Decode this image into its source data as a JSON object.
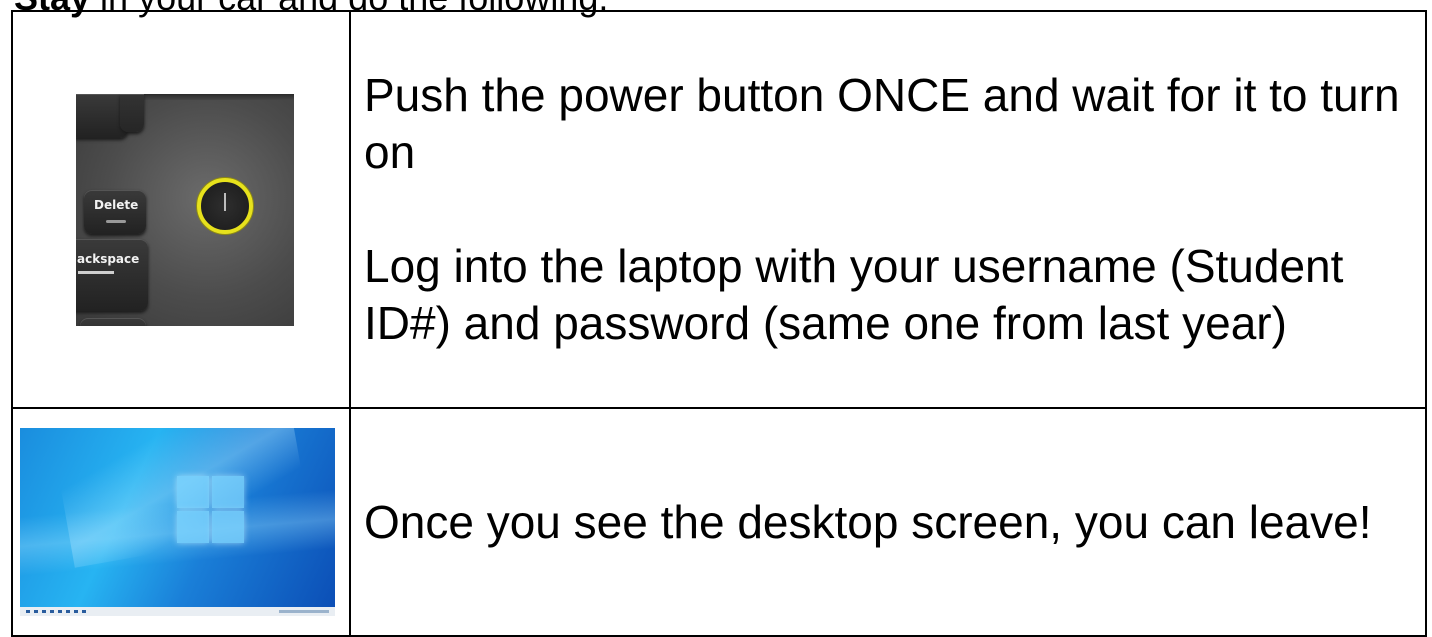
{
  "intro": {
    "bold": "Stay",
    "rest": " in your car and do the following:"
  },
  "rows": [
    {
      "image": {
        "description_icon": "power-button-icon",
        "delete_key": "Delete",
        "backspace_key": "ackspace"
      },
      "paragraphs": [
        "Push the power button ONCE and wait for it to turn on",
        "Log into the laptop with your username (Student ID#) and password (same one from last year)"
      ]
    },
    {
      "image": {
        "description_icon": "windows-logo-icon"
      },
      "paragraphs": [
        "Once you see the desktop screen, you can leave!"
      ]
    }
  ],
  "colors": {
    "power_ring": "#e7e21c",
    "desktop_blue": "#1a7fd8",
    "border": "#000000"
  }
}
